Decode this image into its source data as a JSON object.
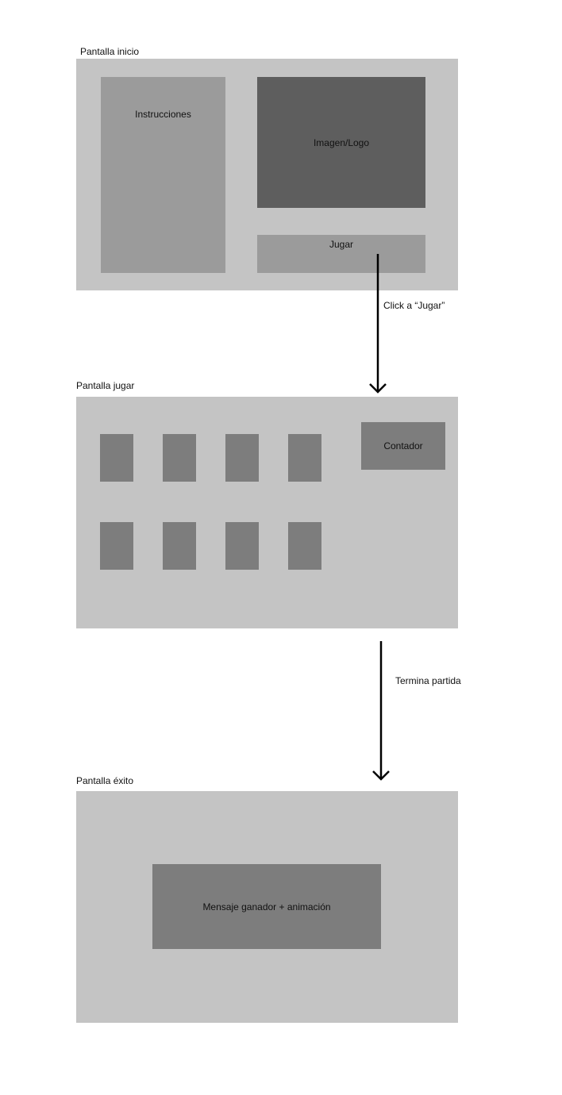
{
  "screens": {
    "inicio": {
      "title": "Pantalla inicio",
      "instructions": "Instrucciones",
      "logo": "Imagen/Logo",
      "play_button": "Jugar"
    },
    "jugar": {
      "title": "Pantalla jugar",
      "counter": "Contador",
      "cards_count": 8
    },
    "exito": {
      "title": "Pantalla éxito",
      "message": "Mensaje ganador + animación"
    }
  },
  "transitions": [
    {
      "label": "Click a “Jugar”"
    },
    {
      "label": "Termina partida"
    }
  ],
  "colors": {
    "screen_bg": "#c4c4c4",
    "panel_light": "#9b9b9b",
    "panel_dark": "#5e5e5e",
    "card": "#7d7d7d",
    "arrow": "#000000"
  }
}
